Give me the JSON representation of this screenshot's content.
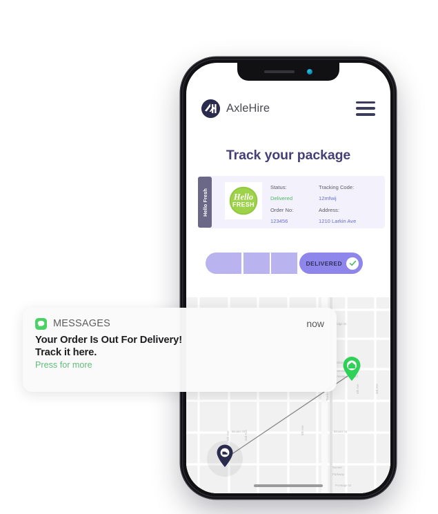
{
  "app": {
    "brand_name": "AxleHire",
    "brand_logo_icon": "axlehire-ah-monogram-icon",
    "menu_icon": "hamburger-menu-icon",
    "page_title": "Track your package"
  },
  "shipment_card": {
    "vendor_tab_label": "Hello Fresh",
    "vendor_logo_icon": "hellofresh-logo",
    "fields": [
      {
        "label": "Status:",
        "value": "Delivered",
        "tone": "success"
      },
      {
        "label": "Tracking Code:",
        "value": "12mfwij",
        "tone": "link"
      },
      {
        "label": "Order No:",
        "value": "123456",
        "tone": "link"
      },
      {
        "label": "Address:",
        "value": "1210 Larkin Ave",
        "tone": "link"
      }
    ]
  },
  "progress": {
    "segments_completed": 3,
    "current_step_label": "DELIVERED",
    "check_icon": "check-circle-icon",
    "track_color": "#b9b3f0",
    "active_color": "#8f86ec",
    "check_color": "#4cb963"
  },
  "map": {
    "origin_marker_icon": "delivery-vehicle-pin-icon",
    "destination_marker_icon": "home-pin-icon",
    "origin_color": "#2b2b4e",
    "destination_color": "#30d158",
    "route_label": "route-line",
    "home_indicator": "home-indicator-bar"
  },
  "notification": {
    "app_icon": "messages-app-icon",
    "app_name": "MESSAGES",
    "time": "now",
    "line_1": "Your Order Is Out For Delivery!",
    "line_2": "Track it here.",
    "action_hint": "Press for more"
  },
  "device": {
    "notch_speaker": "earpiece-speaker",
    "notch_camera": "front-camera"
  }
}
